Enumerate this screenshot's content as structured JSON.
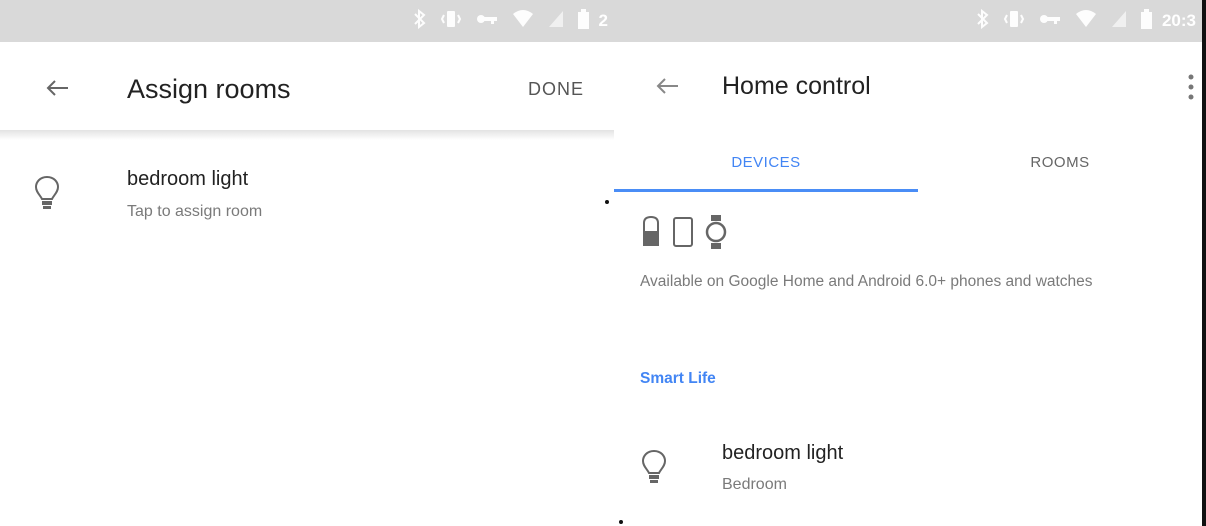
{
  "left_screen": {
    "status_bar": {
      "time": "2"
    },
    "header": {
      "title": "Assign rooms",
      "done_label": "DONE"
    },
    "items": [
      {
        "name": "bedroom light",
        "subtitle": "Tap to assign room"
      }
    ]
  },
  "right_screen": {
    "status_bar": {
      "time": "20:3"
    },
    "header": {
      "title": "Home control"
    },
    "tabs": [
      {
        "label": "DEVICES",
        "selected": true
      },
      {
        "label": "ROOMS",
        "selected": false
      }
    ],
    "info": {
      "text": "Available on Google Home and Android 6.0+ phones and watches"
    },
    "section": {
      "title": "Smart Life"
    },
    "items": [
      {
        "name": "bedroom light",
        "subtitle": "Bedroom"
      }
    ]
  },
  "colors": {
    "accent": "#4285f4",
    "status_bar": "#d9d9d9",
    "secondary_text": "#7a7a7a"
  },
  "icons": [
    "bluetooth-icon",
    "vibrate-icon",
    "key-icon",
    "wifi-icon",
    "signal-icon",
    "battery-icon",
    "back-arrow-icon",
    "bulb-icon",
    "more-vert-icon",
    "speaker-icon",
    "phone-icon",
    "watch-icon"
  ]
}
